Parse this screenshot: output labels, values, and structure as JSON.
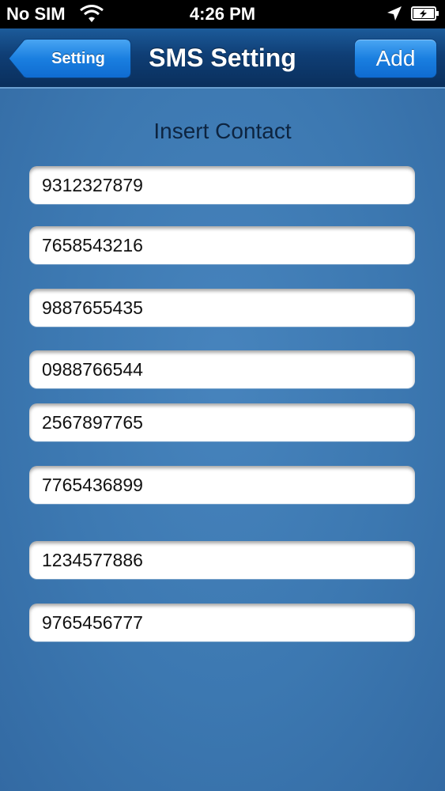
{
  "status_bar": {
    "carrier": "No SIM",
    "time": "4:26 PM",
    "icons": [
      "wifi-icon",
      "location-icon",
      "battery-charging-icon"
    ]
  },
  "nav_bar": {
    "back_label": "Setting",
    "title": "SMS Setting",
    "add_label": "Add"
  },
  "section": {
    "title": "Insert Contact"
  },
  "contacts": [
    "9312327879",
    "7658543216",
    "9887655435",
    "0988766544",
    "2567897765",
    "7765436899",
    "1234577886",
    "9765456777"
  ],
  "colors": {
    "background": "#3b76b0",
    "nav_bar": "#0f3e75",
    "button_blue": "#1a7fe0"
  }
}
